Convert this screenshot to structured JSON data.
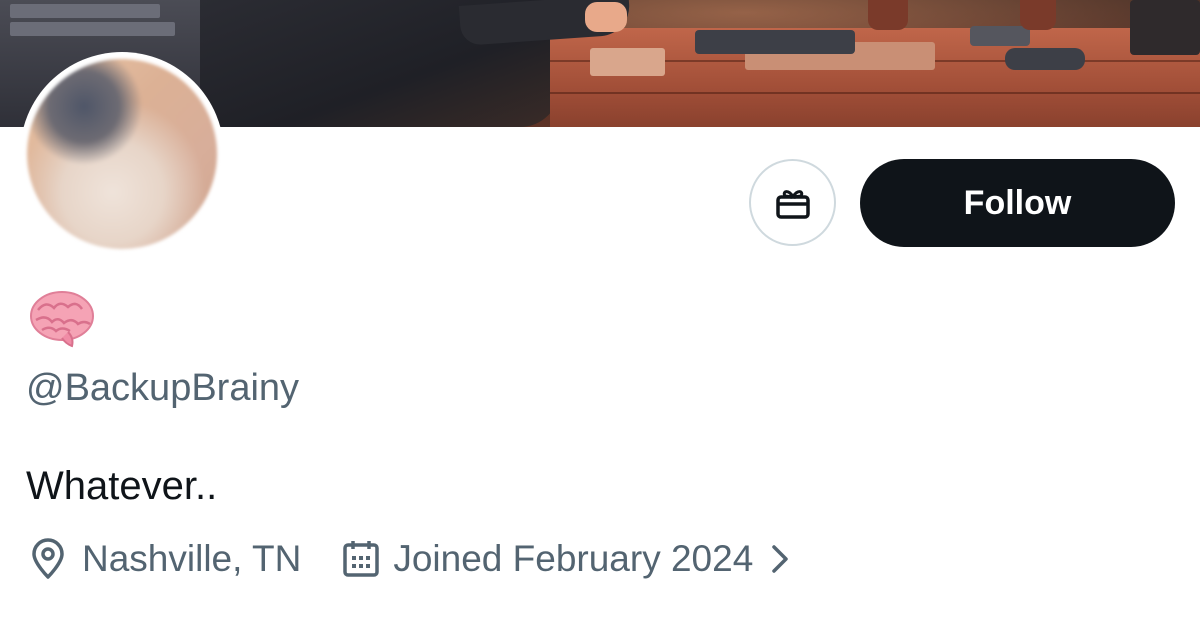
{
  "profile": {
    "emoji_icon": "brain-emoji",
    "handle": "@BackupBrainy",
    "bio": "Whatever..",
    "location": "Nashville, TN",
    "joined": "Joined February 2024"
  },
  "actions": {
    "gift_icon": "gift-icon",
    "follow_label": "Follow"
  },
  "colors": {
    "follow_bg": "#0f1419",
    "follow_text": "#ffffff",
    "secondary_text": "#536471",
    "primary_text": "#0f1419",
    "border": "#cfd9de"
  }
}
